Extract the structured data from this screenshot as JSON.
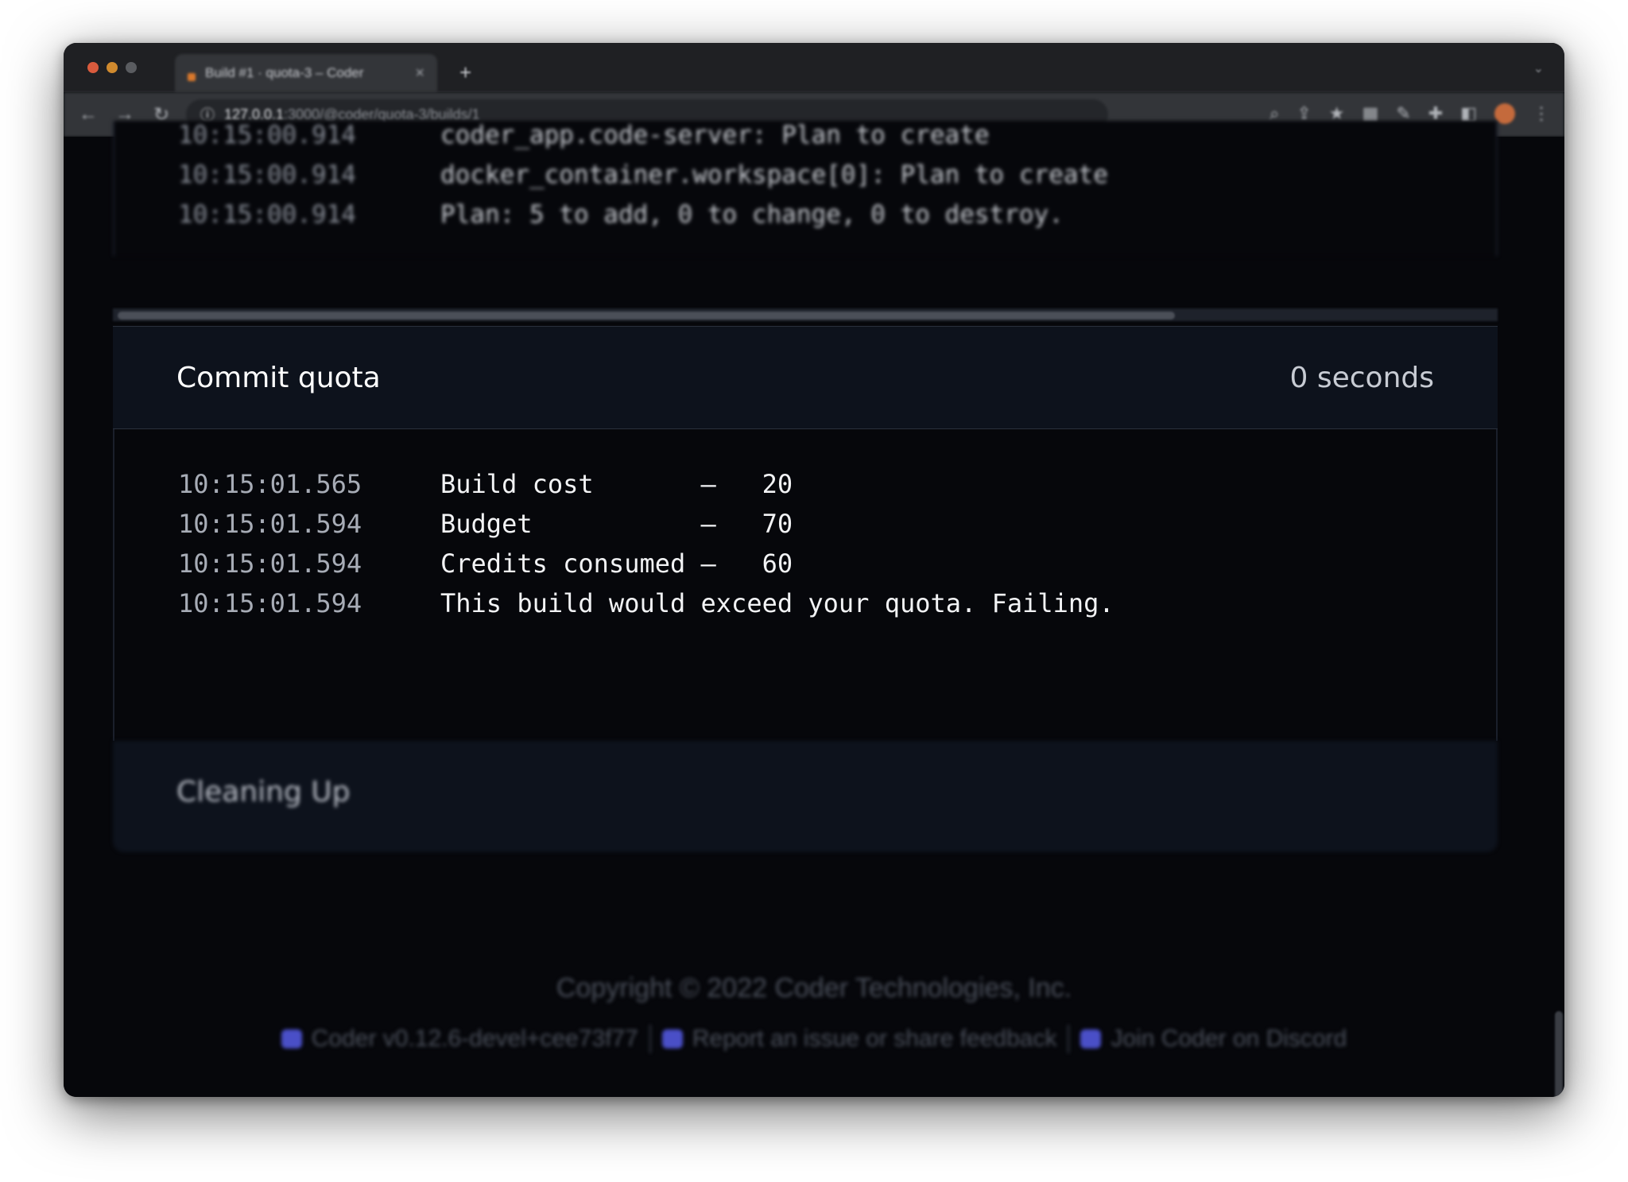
{
  "browser": {
    "tab_title": "Build #1 · quota-3 – Coder",
    "tab_close": "×",
    "new_tab": "+",
    "url_host": "127.0.0.1",
    "url_path": ":3000/@coder/quota-3/builds/1",
    "nav": {
      "back": "←",
      "forward": "→",
      "reload": "↻"
    }
  },
  "previous_logs": [
    {
      "ts": "10:15:00.914",
      "msg": "coder_app.code-server: Plan to create"
    },
    {
      "ts": "10:15:00.914",
      "msg": "docker_container.workspace[0]: Plan to create"
    },
    {
      "ts": "10:15:00.914",
      "msg": "Plan: 5 to add, 0 to change, 0 to destroy."
    }
  ],
  "stage": {
    "title": "Commit quota",
    "duration": "0 seconds"
  },
  "quota_logs": [
    {
      "ts": "10:15:01.565",
      "msg": "Build cost       —   20"
    },
    {
      "ts": "10:15:01.594",
      "msg": "Budget           —   70"
    },
    {
      "ts": "10:15:01.594",
      "msg": "Credits consumed —   60"
    },
    {
      "ts": "10:15:01.594",
      "msg": "This build would exceed your quota. Failing."
    }
  ],
  "next_stage": {
    "title": "Cleaning Up"
  },
  "footer": {
    "copyright": "Copyright © 2022 Coder Technologies, Inc.",
    "version": "Coder v0.12.6-devel+cee73f77",
    "report": "Report an issue or share feedback",
    "discord": "Join Coder on Discord"
  },
  "colors": {
    "background": "#06070b",
    "stage_header": "#0d121c",
    "accent": "#4a4fc7"
  }
}
